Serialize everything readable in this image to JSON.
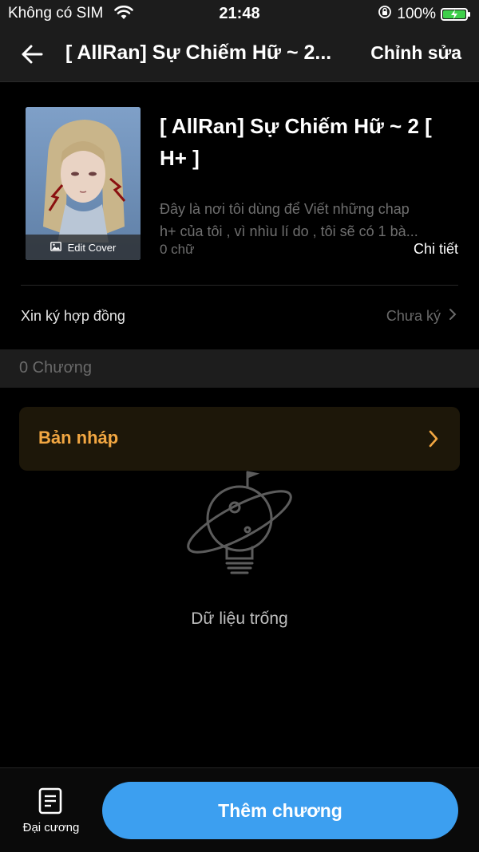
{
  "status_bar": {
    "carrier": "Không có SIM",
    "time": "21:48",
    "battery": "100%",
    "battery_level": 1.0
  },
  "header": {
    "title": "[ AllRan] Sự Chiếm Hữ ~ 2...",
    "edit_label": "Chỉnh sửa"
  },
  "book": {
    "cover_label": "Edit Cover",
    "title": "[ AllRan] Sự Chiếm Hữ ~ 2 [ H+ ]",
    "description_line1": "Đây là nơi tôi dùng để Viết những chap",
    "description_line2": "h+ của tôi , vì nhìu lí do , tôi sẽ có 1 bà...",
    "word_count": "0 chữ",
    "details_label": "Chi tiết"
  },
  "contract": {
    "label": "Xin ký hợp đồng",
    "status": "Chưa ký"
  },
  "chapters": {
    "count_label": "0 Chương"
  },
  "draft": {
    "label": "Bản nháp"
  },
  "empty_state": {
    "text": "Dữ liệu trống"
  },
  "bottom_bar": {
    "outline_label": "Đại cương",
    "add_chapter_label": "Thêm chương"
  },
  "colors": {
    "accent_blue": "#3c9ff0",
    "draft_orange": "#f2a742",
    "background": "#000000"
  }
}
